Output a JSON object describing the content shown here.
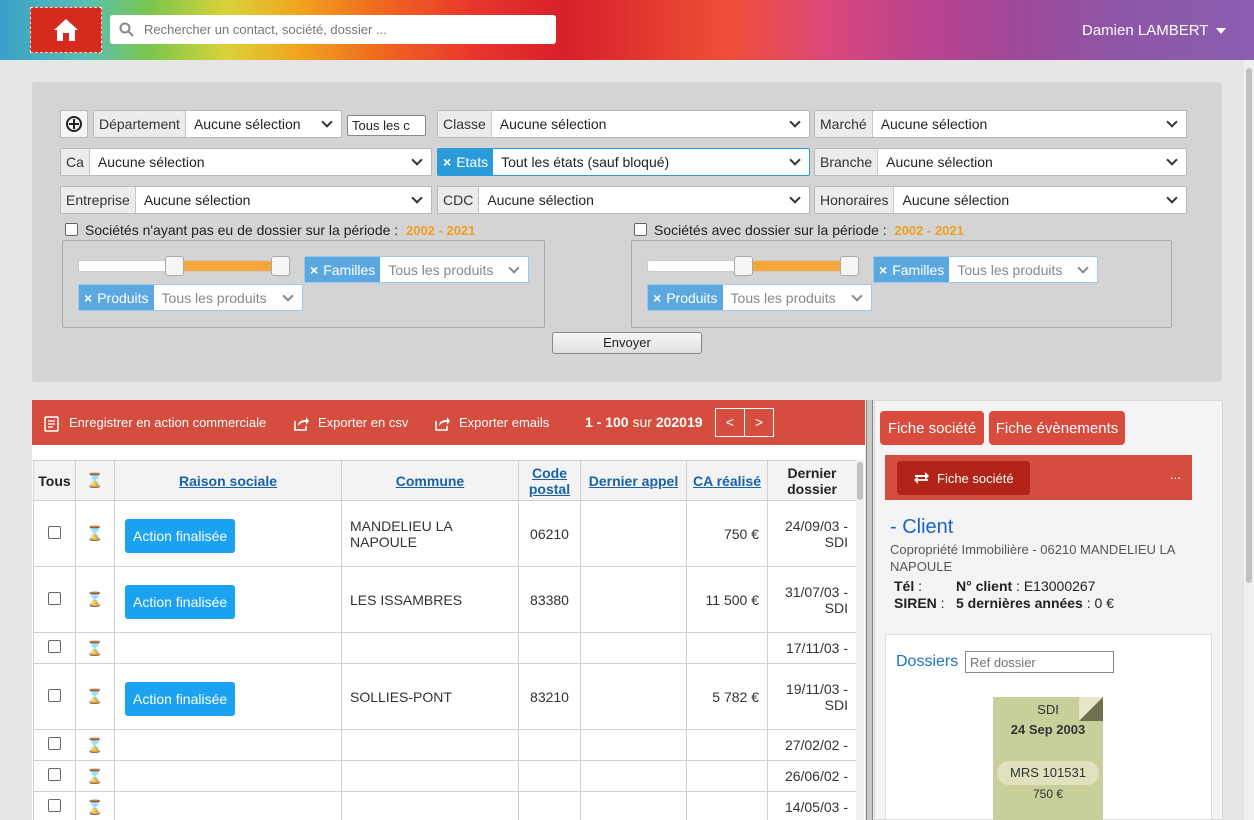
{
  "header": {
    "search_placeholder": "Rechercher un contact, société, dossier ...",
    "user_name": "Damien LAMBERT"
  },
  "filters": {
    "departement": {
      "label": "Département",
      "value": "Aucune sélection"
    },
    "tous_les": "Tous les c",
    "classe": {
      "label": "Classe",
      "value": "Aucune sélection"
    },
    "marche": {
      "label": "Marché",
      "value": "Aucune sélection"
    },
    "ca": {
      "label": "Ca",
      "value": "Aucune sélection"
    },
    "etats": {
      "label": "Etats",
      "value": "Tout les états (sauf bloqué)"
    },
    "branche": {
      "label": "Branche",
      "value": "Aucune sélection"
    },
    "entreprise": {
      "label": "Entreprise",
      "value": "Aucune sélection"
    },
    "cdc": {
      "label": "CDC",
      "value": "Aucune sélection"
    },
    "honoraires": {
      "label": "Honoraires",
      "value": "Aucune sélection"
    },
    "sans_dossier": {
      "label": "Sociétés n'ayant pas eu de dossier sur la période :",
      "year_from": "2002",
      "sep": " - ",
      "year_to": "2021"
    },
    "avec_dossier": {
      "label": "Sociétés avec dossier sur la période :",
      "year_from": "2002",
      "sep": " - ",
      "year_to": "2021"
    },
    "familles": {
      "label": "Familles",
      "value": "Tous les produits"
    },
    "produits": {
      "label": "Produits",
      "value": "Tous les produits"
    },
    "send_label": "Envoyer"
  },
  "toolbar": {
    "save_action": "Enregistrer en action commerciale",
    "export_csv": "Exporter en csv",
    "export_emails": "Exporter emails",
    "range": "1 - 100",
    "sur": " sur ",
    "total": "202019",
    "prev": "<",
    "next": ">"
  },
  "table": {
    "headers": {
      "tous": "Tous",
      "raison": "Raison sociale",
      "commune": "Commune",
      "code_postal": "Code postal",
      "dernier_appel": "Dernier appel",
      "ca": "CA réalisé",
      "dernier_dossier": "Dernier dossier"
    },
    "action_label": "Action finalisée",
    "rows": [
      {
        "commune": "MANDELIEU LA NAPOULE",
        "cp": "06210",
        "ca": "750 €",
        "dossier": "24/09/03 - SDI"
      },
      {
        "commune": "LES ISSAMBRES",
        "cp": "83380",
        "ca": "11 500 €",
        "dossier": "31/07/03 - SDI"
      },
      {
        "commune": "",
        "cp": "",
        "ca": "",
        "dossier": "17/11/03 -"
      },
      {
        "commune": "SOLLIES-PONT",
        "cp": "83210",
        "ca": "5 782 €",
        "dossier": "19/11/03 - SDI"
      },
      {
        "commune": "",
        "cp": "",
        "ca": "",
        "dossier": "27/02/02 -"
      },
      {
        "commune": "",
        "cp": "",
        "ca": "",
        "dossier": "26/06/02 -"
      },
      {
        "commune": "",
        "cp": "",
        "ca": "",
        "dossier": "14/05/03 -"
      }
    ]
  },
  "right": {
    "tab_societe": "Fiche société",
    "tab_evenements": "Fiche évènements",
    "fiche_btn": "Fiche société",
    "dots": "...",
    "client_title": "- Client",
    "address": "Copropriété Immobilière - 06210 MANDELIEU LA NAPOULE",
    "tel_label": "Tél",
    "tel_sep": " :",
    "siren_label": "SIREN",
    "siren_sep": " :",
    "num_client_label": "N° client",
    "num_client_value": " : E13000267",
    "ca5_label": "5 dernières années",
    "ca5_value": " : 0 €",
    "dossiers_title": "Dossiers",
    "ref_placeholder": "Ref dossier",
    "card": {
      "type": "SDI",
      "date": "24 Sep 2003",
      "ref": "MRS 101531",
      "amount": "750 €"
    }
  }
}
